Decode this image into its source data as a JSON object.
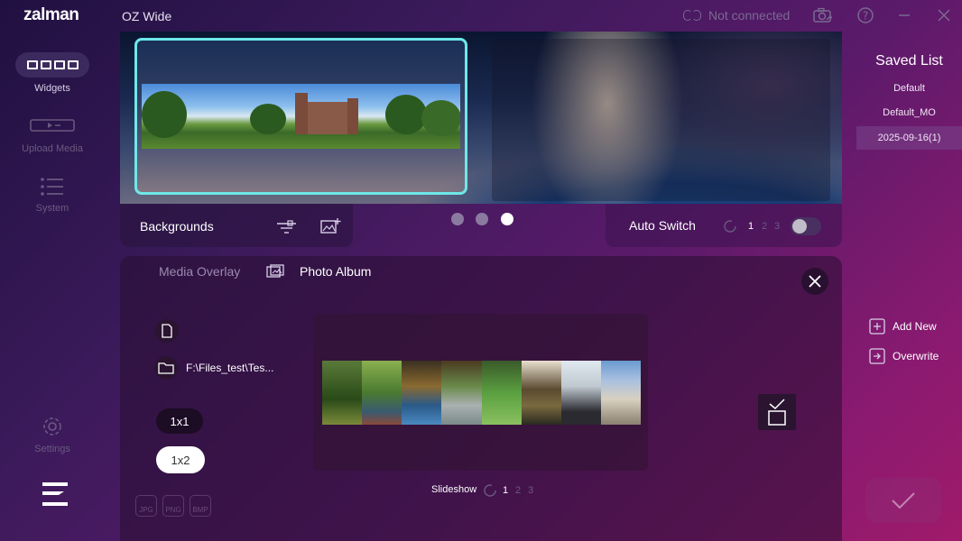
{
  "titlebar": {
    "logo": "zalman",
    "app_title": "OZ Wide",
    "connection_status": "Not connected"
  },
  "sidebar": {
    "items": [
      {
        "label": "Widgets"
      },
      {
        "label": "Upload Media"
      },
      {
        "label": "System"
      },
      {
        "label": "Settings"
      }
    ]
  },
  "backgrounds": {
    "label": "Backgrounds",
    "page_dots": 3,
    "active_dot": 3
  },
  "auto_switch": {
    "label": "Auto Switch",
    "options": [
      "1",
      "2",
      "3"
    ],
    "selected": "1",
    "enabled": false
  },
  "overlay": {
    "tabs": [
      {
        "label": "Media Overlay"
      },
      {
        "label": "Photo Album"
      }
    ],
    "active_tab": "Photo Album",
    "folder_path": "F:\\Files_test\\Tes...",
    "layout_buttons": [
      {
        "label": "1x1"
      },
      {
        "label": "1x2"
      }
    ],
    "selected_layout": "1x2",
    "formats": [
      "JPG",
      "PNG",
      "BMP"
    ],
    "slideshow": {
      "label": "Slideshow",
      "options": [
        "1",
        "2",
        "3"
      ],
      "selected": "1"
    }
  },
  "saved_list": {
    "title": "Saved List",
    "items": [
      "Default",
      "Default_MO",
      "2025-09-16(1)"
    ],
    "selected": "2025-09-16(1)"
  },
  "actions": {
    "add_new": "Add New",
    "overwrite": "Overwrite"
  },
  "colors": {
    "accent_cyan": "#6ee8e8",
    "bg_purple": "#3a1a5a",
    "bg_magenta": "#a01a6a"
  }
}
